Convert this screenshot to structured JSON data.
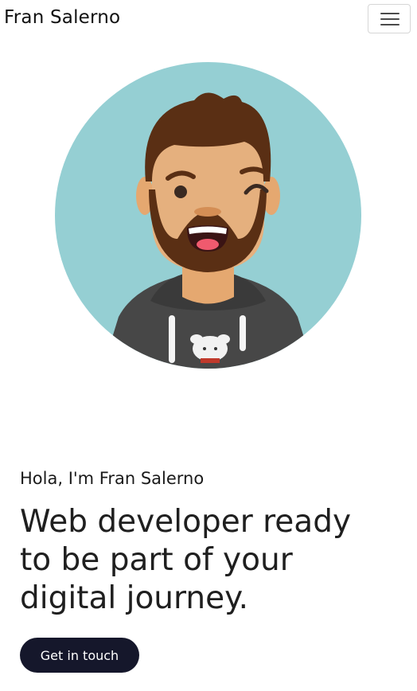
{
  "navbar": {
    "brand": "Fran Salerno",
    "toggler_icon": "hamburger-menu-icon"
  },
  "hero": {
    "avatar_icon": "cartoon-avatar-winking-man",
    "avatar_bg_color": "#95cfd3",
    "greeting": "Hola, I'm Fran Salerno",
    "headline_lines": [
      "Web developer ready",
      "to be part of your",
      "digital journey."
    ],
    "cta_label": "Get in touch",
    "cta_color": "#15172b"
  }
}
